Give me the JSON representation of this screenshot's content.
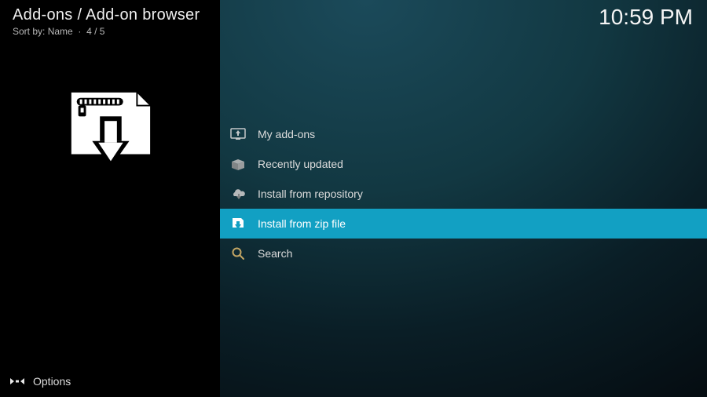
{
  "header": {
    "breadcrumb": "Add-ons / Add-on browser",
    "sort_label": "Sort by:",
    "sort_value": "Name",
    "position": "4 / 5"
  },
  "clock": "10:59 PM",
  "preview_icon": "zip-download-icon",
  "menu": {
    "items": [
      {
        "icon": "my-addons-icon",
        "label": "My add-ons",
        "selected": false
      },
      {
        "icon": "box-open-icon",
        "label": "Recently updated",
        "selected": false
      },
      {
        "icon": "cloud-download-icon",
        "label": "Install from repository",
        "selected": false
      },
      {
        "icon": "zip-download-small-icon",
        "label": "Install from zip file",
        "selected": true
      },
      {
        "icon": "search-icon",
        "label": "Search",
        "selected": false
      }
    ]
  },
  "footer": {
    "options_label": "Options"
  },
  "colors": {
    "accent": "#12a0c3"
  }
}
